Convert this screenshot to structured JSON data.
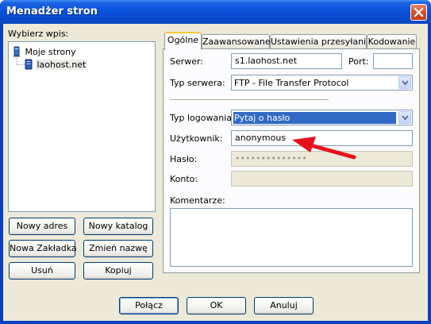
{
  "window": {
    "title": "Menadżer stron"
  },
  "left": {
    "label": "Wybierz wpis:",
    "tree": {
      "root": "Moje strony",
      "child": "laohost.net"
    },
    "buttons": {
      "new_site": "Nowy adres",
      "new_folder": "Nowy katalog",
      "new_bookmark": "Nowa Zakładka",
      "rename": "Zmień nazwę",
      "delete": "Usuń",
      "copy": "Kopiuj"
    }
  },
  "tabs": [
    "Ogólne",
    "Zaawansowane",
    "Ustawienia przesyłania",
    "Kodowanie"
  ],
  "general": {
    "server_label": "Serwer:",
    "server_value": "s1.laohost.net",
    "port_label": "Port:",
    "port_value": "",
    "server_type_label": "Typ serwera:",
    "server_type_value": "FTP - File Transfer Protocol",
    "logon_type_label": "Typ logowania:",
    "logon_type_value": "Pytaj o hasło",
    "user_label": "Użytkownik:",
    "user_value": "anonymous",
    "password_label": "Hasło:",
    "password_value": "••••••••••••••",
    "account_label": "Konto:",
    "account_value": "",
    "comments_label": "Komentarze:"
  },
  "footer": {
    "connect": "Połącz",
    "ok": "OK",
    "cancel": "Anuluj"
  },
  "colors": {
    "titlebar": "#0a55dc",
    "face": "#ece9d8",
    "selection": "#316ac5",
    "annotation_arrow": "#e8101c"
  },
  "icons": [
    "close-icon",
    "computer-icon",
    "server-icon",
    "dropdown-arrow-icon",
    "red-arrow-annotation"
  ]
}
